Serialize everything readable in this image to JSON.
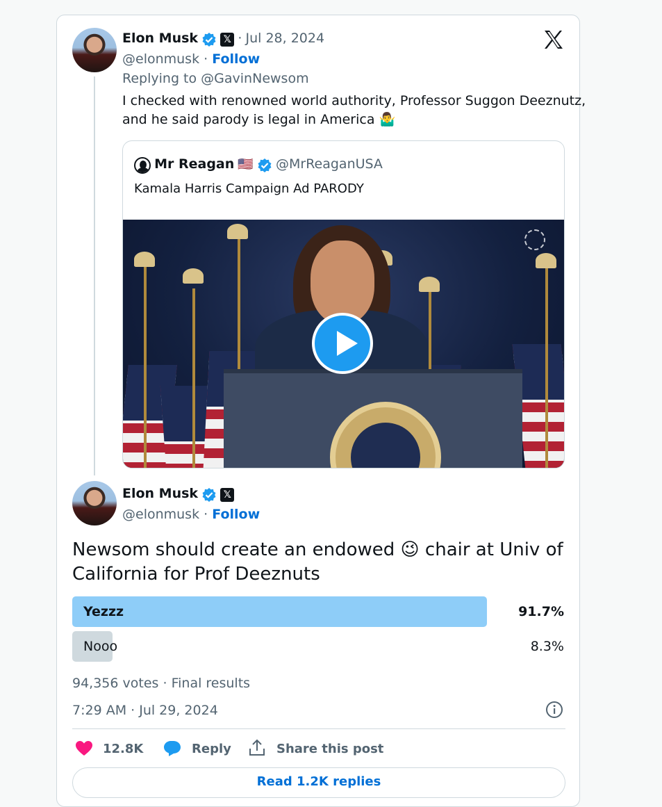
{
  "reply_tweet": {
    "author_name": "Elon Musk",
    "handle": "@elonmusk",
    "separator": "·",
    "follow_label": "Follow",
    "date": "Jul 28, 2024",
    "replying_to_prefix": "Replying to",
    "replying_to_handle": "@GavinNewsom",
    "text_line1": "I checked with renowned world authority, Professor Suggon Deeznutz,",
    "text_line2": "and he said parody is legal in America 🤷‍♂️"
  },
  "quoted_tweet": {
    "author_name": "Mr Reagan",
    "flag": "🇺🇸",
    "handle": "@MrReaganUSA",
    "text": "Kamala Harris Campaign Ad PARODY",
    "media_type": "video"
  },
  "main_tweet": {
    "author_name": "Elon Musk",
    "handle": "@elonmusk",
    "separator": "·",
    "follow_label": "Follow",
    "text_part1": "Newsom should create an endowed",
    "emoji": "😉",
    "text_part2": "chair at Univ of",
    "text_line2": "California for Prof Deeznuts",
    "poll": {
      "options": [
        {
          "label": "Yezzz",
          "percent": "91.7%",
          "fraction": 0.917,
          "winner": true
        },
        {
          "label": "Nooo",
          "percent": "8.3%",
          "fraction": 0.083,
          "winner": false
        }
      ],
      "votes": "94,356 votes",
      "status": "Final results"
    },
    "timestamp": "7:29 AM · Jul 29, 2024",
    "likes": "12.8K",
    "reply_label": "Reply",
    "share_label": "Share this post",
    "read_replies_label": "Read 1.2K replies"
  },
  "colors": {
    "accent": "#1d9bf0",
    "link": "#006fd6",
    "poll_winner": "#8ecdf8",
    "poll_other": "#cfd9de",
    "like": "#f91880",
    "muted": "#536471"
  },
  "icons": [
    "verified-badge-icon",
    "x-logo-icon",
    "play-icon",
    "heart-icon",
    "reply-bubble-icon",
    "share-icon",
    "info-icon"
  ]
}
